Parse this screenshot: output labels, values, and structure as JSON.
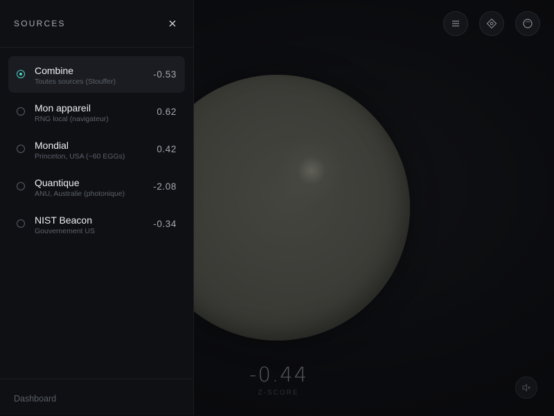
{
  "panel": {
    "title": "SOURCES",
    "sources": [
      {
        "name": "Combine",
        "subtitle": "Toutes sources (Stouffer)",
        "value": "-0.53",
        "selected": true
      },
      {
        "name": "Mon appareil",
        "subtitle": "RNG local (navigateur)",
        "value": "0.62",
        "selected": false
      },
      {
        "name": "Mondial",
        "subtitle": "Princeton, USA (~60 EGGs)",
        "value": "0.42",
        "selected": false
      },
      {
        "name": "Quantique",
        "subtitle": "ANU, Australie (photonique)",
        "value": "-2.08",
        "selected": false
      },
      {
        "name": "NIST Beacon",
        "subtitle": "Gouvernement US",
        "value": "-0.34",
        "selected": false
      }
    ],
    "footer_link": "Dashboard"
  },
  "main": {
    "score_value": "-0.44",
    "score_label": "Z-SCORE"
  },
  "icons": {
    "close": "close-icon",
    "menu": "menu-icon",
    "locate": "locate-icon",
    "circle": "circle-icon",
    "sound": "sound-muted-icon"
  },
  "colors": {
    "accent": "#4fd1c5",
    "background": "#0a0b0e",
    "panel": "#0e1014",
    "orb": "#3f3f3a"
  }
}
